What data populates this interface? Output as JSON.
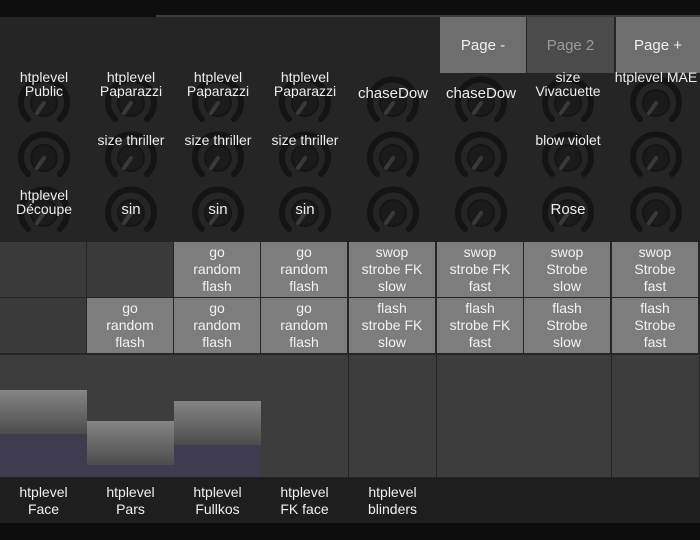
{
  "paging": {
    "prev_label": "Page -",
    "current_label": "Page 2",
    "next_label": "Page +"
  },
  "knob_rows": [
    [
      "htplevel Public",
      "htplevel Paparazzi",
      "htplevel Paparazzi",
      "htplevel Paparazzi",
      "chaseDow",
      "chaseDow",
      "size Vivacuette",
      "htplevel MAE"
    ],
    [
      "",
      "size thriller",
      "size thriller",
      "size thriller",
      "",
      "",
      "blow violet",
      ""
    ],
    [
      "htplevel Découpe",
      "sin",
      "sin",
      "sin",
      "",
      "",
      "Rose",
      ""
    ]
  ],
  "button_rows": [
    [
      "",
      "",
      "go\nrandom\nflash",
      "go\nrandom\nflash",
      "swop\nstrobe FK\nslow",
      "swop\nstrobe FK\nfast",
      "swop\nStrobe\nslow",
      "swop\nStrobe\nfast"
    ],
    [
      "",
      "go\nrandom\nflash",
      "go\nrandom\nflash",
      "go\nrandom\nflash",
      "flash\nstrobe FK\nslow",
      "flash\nstrobe FK\nfast",
      "flash\nStrobe\nslow",
      "flash\nStrobe\nfast"
    ]
  ],
  "faders": [
    {
      "label": "htplevel\nFace",
      "level": 0.71
    },
    {
      "label": "htplevel\nPars",
      "level": 0.46
    },
    {
      "label": "htplevel\nFullkos",
      "level": 0.62
    },
    {
      "label": "htplevel\nFK face",
      "level": 0
    },
    {
      "label": "htplevel\nblinders",
      "level": 0
    },
    {
      "label": "",
      "level": 0
    },
    {
      "label": "",
      "level": 0
    },
    {
      "label": "",
      "level": 0
    }
  ]
}
